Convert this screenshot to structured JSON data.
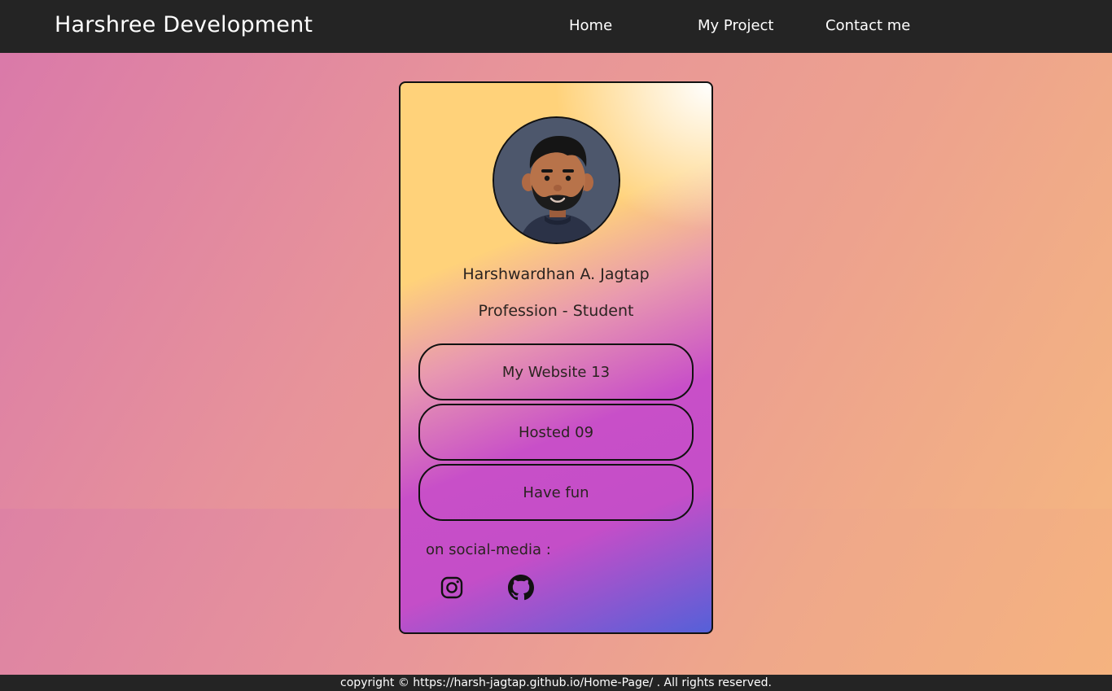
{
  "navbar": {
    "brand": "Harshree Development",
    "links": [
      "Home",
      "My Project",
      "Contact me"
    ]
  },
  "profile": {
    "name": "Harshwardhan A. Jagtap",
    "profession": "Profession - Student",
    "buttons": [
      "My Website 13",
      "Hosted 09",
      "Have fun"
    ],
    "social_label": "on social-media :",
    "social_icons": [
      "instagram-icon",
      "github-icon"
    ]
  },
  "footer": {
    "text": "copyright © https://harsh-jagtap.github.io/Home-Page/ . All rights reserved."
  },
  "colors": {
    "navbar_bg": "#242424",
    "footer_bg": "#242424",
    "page_gradient_start": "#d978aa",
    "page_gradient_end": "#f6b97e",
    "card_gradient_top": "#ffd27a",
    "card_gradient_mid": "#c84fc8",
    "card_gradient_bottom": "#5560d8"
  }
}
